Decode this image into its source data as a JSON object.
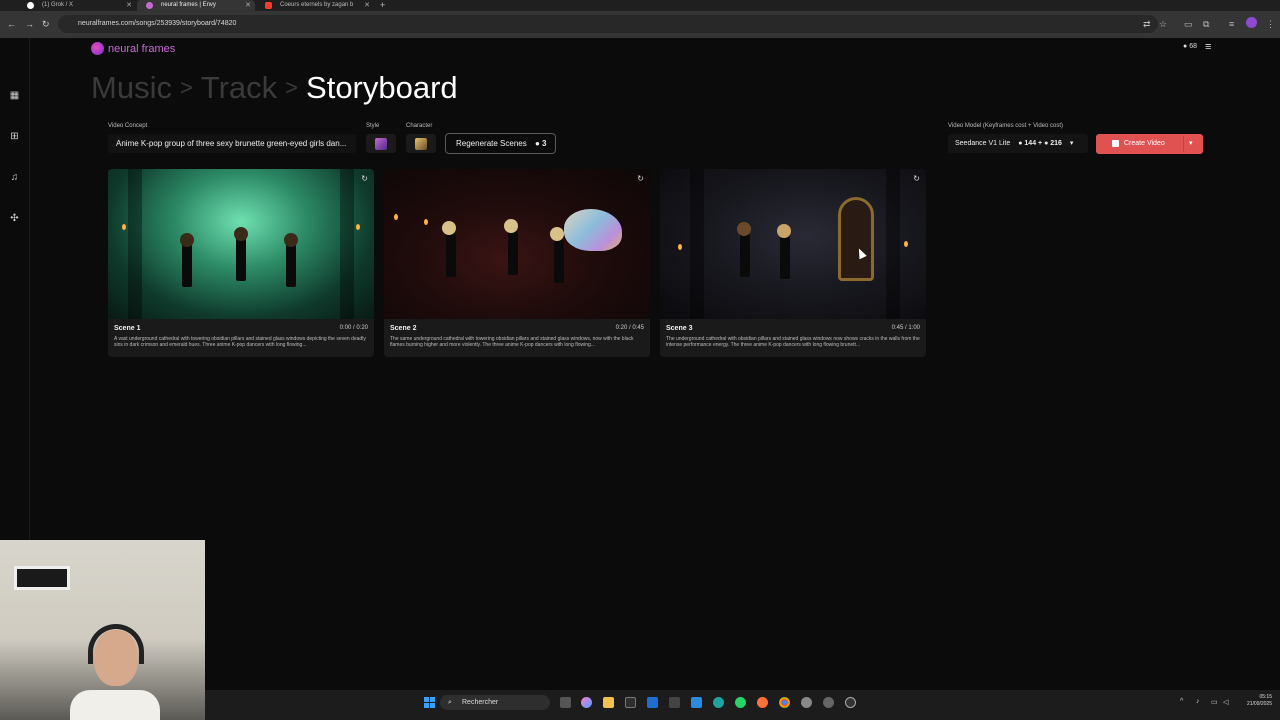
{
  "browser": {
    "tabs": [
      {
        "title": "(1) Grok / X",
        "active": false
      },
      {
        "title": "neural frames | Envy",
        "active": true
      },
      {
        "title": "Coeurs eternels by zagan b",
        "active": false
      }
    ],
    "new_tab": "+",
    "url": "neuralframes.com/songs/253939/storyboard/74820"
  },
  "app": {
    "logo_text": "neural frames",
    "credits": "68",
    "breadcrumb": {
      "music": "Music",
      "track": "Track",
      "current": "Storyboard",
      "sep": ">"
    },
    "video_concept_label": "Video Concept",
    "video_concept_value": "Anime K-pop group of three sexy brunette green-eyed girls dan...",
    "style_label": "Style",
    "character_label": "Character",
    "regenerate_label": "Regenerate Scenes",
    "regenerate_cost": "3",
    "video_model_label": "Video Model (Keyframes cost + Video cost)",
    "video_model_value": "Seedance V1 Lite",
    "keyframes_cost": "144",
    "video_cost": "216",
    "create_video_label": "Create Video",
    "scenes": [
      {
        "title": "Scene 1",
        "time": "0:00 / 0:20",
        "desc": "A vast underground cathedral with towering obsidian pillars and stained glass windows depicting the seven deadly sins in dark crimson and emerald hues. Three anime K-pop dancers with long flowing..."
      },
      {
        "title": "Scene 2",
        "time": "0:20 / 0:45",
        "desc": "The same underground cathedral with towering obsidian pillars and stained glass windows, now with the black flames burning higher and more violently. The three anime K-pop dancers with long flowing..."
      },
      {
        "title": "Scene 3",
        "time": "0:45 / 1:00",
        "desc": "The underground cathedral with obsidian pillars and stained glass windows now shows cracks in the walls from the intense performance energy. The three anime K-pop dancers with long flowing brunett..."
      }
    ]
  },
  "taskbar": {
    "search_placeholder": "Rechercher",
    "time": "05:15",
    "date": "21/09/2025"
  },
  "colors": {
    "accent": "#e05252",
    "brand": "#c86ad4"
  }
}
